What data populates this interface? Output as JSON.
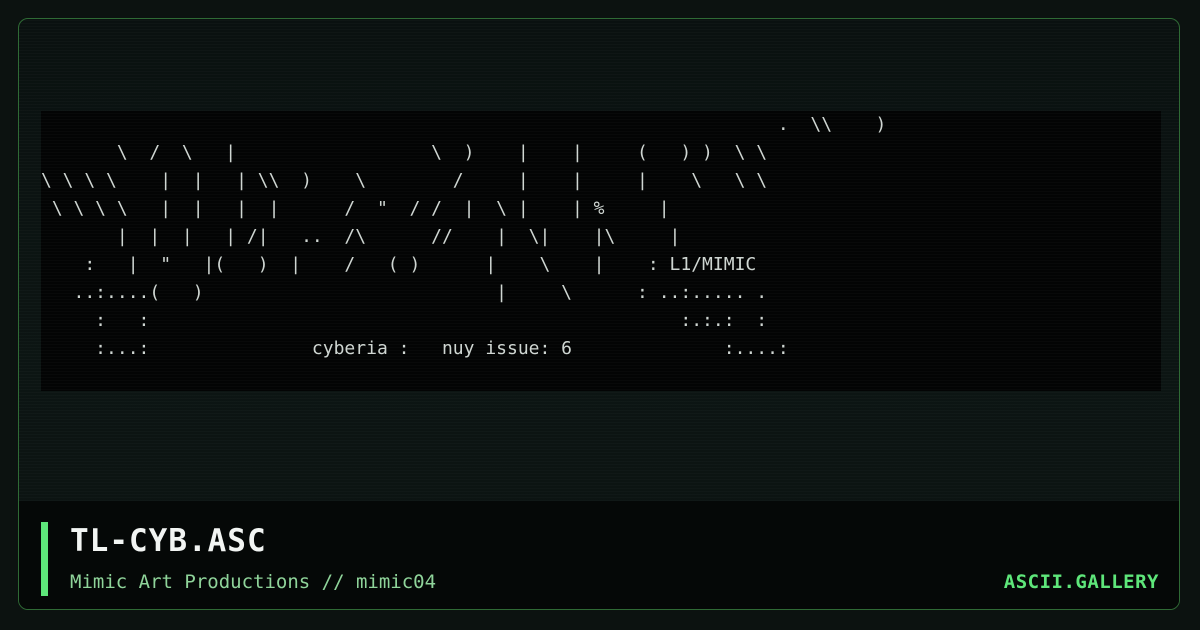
{
  "card": {
    "title": "TL-CYB.ASC",
    "subtitle": "Mimic Art Productions // mimic04",
    "brand": "ASCII.GALLERY"
  },
  "art": {
    "text": "                                                                    .  \\\\    )\n       \\  /  \\   |                  \\  )    |    |     (   ) )  \\ \\\n\\ \\ \\ \\    |  |   | \\\\  )    \\        /     |    |     |    \\   \\ \\\n \\ \\ \\ \\   |  |   |  |      /  \"  / /  |  \\ |    | %     |\n       |  |  |   | /|   ..  /\\      //    |  \\|    |\\     |\n    :   |  \"   |(   )  |    /   ( )      |    \\    |    : L1/MIMIC\n   ..:....(   )                           |     \\      : ..:..... .\n     :   :                                                 :.:.:  :\n     :...:               cyberia :   nuy issue: 6              :....:"
  }
}
